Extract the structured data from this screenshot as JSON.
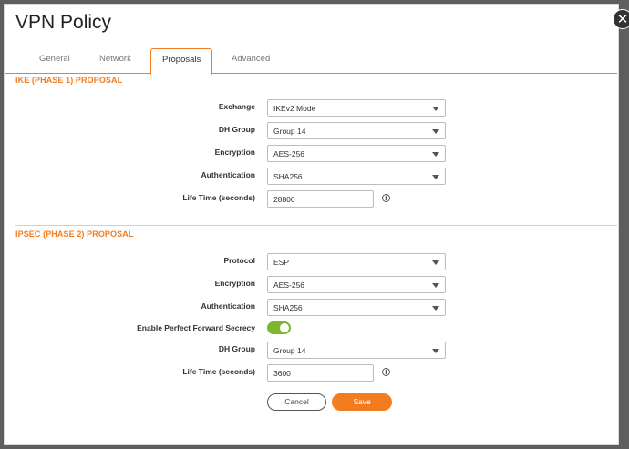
{
  "dialog": {
    "title": "VPN Policy",
    "close_glyph": "✕"
  },
  "tabs": [
    {
      "label": "General",
      "active": false
    },
    {
      "label": "Network",
      "active": false
    },
    {
      "label": "Proposals",
      "active": true
    },
    {
      "label": "Advanced",
      "active": false
    }
  ],
  "ike": {
    "section_title": "IKE (PHASE 1) PROPOSAL",
    "exchange": {
      "label": "Exchange",
      "value": "IKEv2 Mode"
    },
    "dh_group": {
      "label": "DH Group",
      "value": "Group 14"
    },
    "encryption": {
      "label": "Encryption",
      "value": "AES-256"
    },
    "authentication": {
      "label": "Authentication",
      "value": "SHA256"
    },
    "life_time": {
      "label": "Life Time (seconds)",
      "value": "28800"
    }
  },
  "ipsec": {
    "section_title": "IPSEC (PHASE 2) PROPOSAL",
    "protocol": {
      "label": "Protocol",
      "value": "ESP"
    },
    "encryption": {
      "label": "Encryption",
      "value": "AES-256"
    },
    "authentication": {
      "label": "Authentication",
      "value": "SHA256"
    },
    "pfs": {
      "label": "Enable Perfect Forward Secrecy",
      "enabled": true
    },
    "dh_group": {
      "label": "DH Group",
      "value": "Group 14"
    },
    "life_time": {
      "label": "Life Time (seconds)",
      "value": "3600"
    }
  },
  "info_glyph": "i",
  "buttons": {
    "cancel": "Cancel",
    "save": "Save"
  },
  "colors": {
    "accent": "#f47c20",
    "toggle_on": "#7cb82f"
  }
}
